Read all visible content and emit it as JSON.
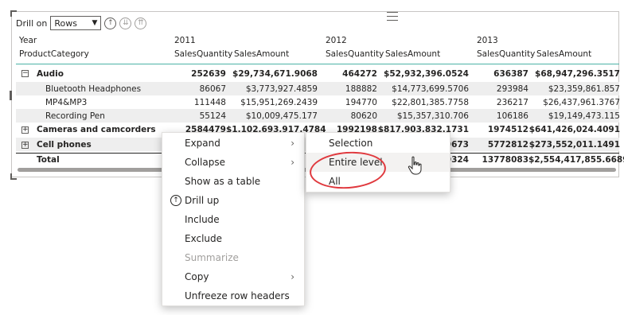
{
  "toolbar": {
    "drill_label": "Drill on",
    "drill_value": "Rows",
    "icons": [
      "drill-up-icon",
      "drill-down-icon",
      "expand-all-icon"
    ]
  },
  "table": {
    "header": {
      "year_label": "Year",
      "category_label": "ProductCategory",
      "years": [
        "2011",
        "2012",
        "2013"
      ],
      "qty_label": "SalesQuantity",
      "amount_label": "SalesAmount"
    },
    "rows": [
      {
        "label": "Audio",
        "level": 0,
        "expander": "−",
        "values": [
          "252639",
          "$29,734,671.9068",
          "464272",
          "$52,932,396.0524",
          "636387",
          "$68,947,296.3517"
        ]
      },
      {
        "label": "Bluetooth Headphones",
        "level": 1,
        "values": [
          "86067",
          "$3,773,927.4859",
          "188882",
          "$14,773,699.5706",
          "293984",
          "$23,359,861.857"
        ]
      },
      {
        "label": "MP4&MP3",
        "level": 1,
        "values": [
          "111448",
          "$15,951,269.2439",
          "194770",
          "$22,801,385.7758",
          "236217",
          "$26,437,961.3767"
        ]
      },
      {
        "label": "Recording Pen",
        "level": 1,
        "values": [
          "55124",
          "$10,009,475.177",
          "80620",
          "$15,357,310.706",
          "106186",
          "$19,149,473.115"
        ]
      },
      {
        "label": "Cameras and camcorders",
        "level": 0,
        "expander": "+",
        "values": [
          "2584479",
          "$1,102,693,917.4784",
          "1992198",
          "$817,903,832.1731",
          "1974512",
          "$641,426,024.4091"
        ]
      },
      {
        "label": "Cell phones",
        "level": 0,
        "expander": "+",
        "values": [
          "",
          "",
          "",
          "0673",
          "5772812",
          "$273,552,011.1491"
        ]
      },
      {
        "label": "Total",
        "level": 0,
        "values": [
          "",
          "",
          "",
          "0324",
          "13778083",
          "$2,554,417,855.6689"
        ]
      }
    ]
  },
  "context_menu": {
    "items": [
      {
        "label": "Expand",
        "submenu": true
      },
      {
        "label": "Collapse",
        "submenu": true
      },
      {
        "label": "Show as a table"
      },
      {
        "label": "Drill up",
        "icon": "drill-up-icon"
      },
      {
        "label": "Include"
      },
      {
        "label": "Exclude"
      },
      {
        "label": "Summarize",
        "disabled": true
      },
      {
        "label": "Copy",
        "submenu": true
      },
      {
        "label": "Unfreeze row headers"
      }
    ]
  },
  "submenu": {
    "items": [
      {
        "label": "Selection"
      },
      {
        "label": "Entire level",
        "hovered": true
      },
      {
        "label": "All"
      }
    ]
  },
  "colors": {
    "accent_line": "#4bb2a6",
    "annotation": "#e0393e",
    "row_band": "#eeeeee"
  }
}
